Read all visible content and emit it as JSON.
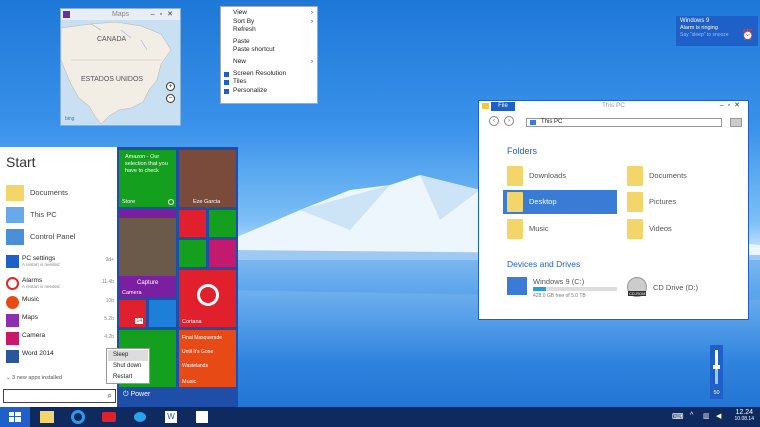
{
  "maps": {
    "title": "Maps",
    "labels": [
      "CANADA",
      "ESTADOS UNIDOS"
    ],
    "zoom_in": "+",
    "zoom_out": "−",
    "logo": "bing"
  },
  "context_menu": {
    "items": [
      {
        "label": "View",
        "arrow": "›"
      },
      {
        "label": "Sort By",
        "arrow": "›"
      },
      {
        "label": "Refresh"
      },
      {
        "label": "Paste"
      },
      {
        "label": "Paste shortcut"
      },
      {
        "label": "New",
        "arrow": "›"
      },
      {
        "label": "Screen Resolution"
      },
      {
        "label": "Tiles"
      },
      {
        "label": "Personalize"
      }
    ]
  },
  "toast": {
    "title": "Windows 9",
    "text": "Alarm is ringing",
    "sub": "Say \"sleep\" to snooze"
  },
  "explorer": {
    "file_tab": "File",
    "title": "This PC",
    "address": "This PC",
    "folders_header": "Folders",
    "folders": [
      "Downloads",
      "Documents",
      "Desktop",
      "Pictures",
      "Music",
      "Videos"
    ],
    "drives_header": "Devices and Drives",
    "drives": [
      {
        "name": "Windows 9 (C:)",
        "info": "428.0 GB free of 5.0 TB",
        "fill": 0.15
      },
      {
        "name": "CD Drive (D:)",
        "badge": "CD-ROM"
      }
    ]
  },
  "start": {
    "title": "Start",
    "pinned": [
      "Documents",
      "This PC",
      "Control Panel"
    ],
    "apps": [
      {
        "name": "PC settings",
        "sub": "A restart is needed",
        "count": "9d+"
      },
      {
        "name": "Alarms",
        "sub": "A restart is needed",
        "count": "11.4b"
      },
      {
        "name": "Music",
        "count": "10b"
      },
      {
        "name": "Maps",
        "count": "5.2b"
      },
      {
        "name": "Camera",
        "count": "4.2b"
      },
      {
        "name": "Word 2014",
        "count": ""
      }
    ],
    "more": "3 new apps installed",
    "power": "Power",
    "power_menu": [
      "Sleep",
      "Shut down",
      "Restart"
    ],
    "tiles": {
      "store_text": "Amazon - Our selection that you have to check",
      "store": "Store",
      "person": "Eze Garcia",
      "capture": "Capture",
      "camera": "Camera",
      "badge": "14",
      "cortana": "Cortana",
      "music_lines": [
        "Final Masquerade",
        "Until It's Gone",
        "Wastelands"
      ],
      "music": "Music"
    }
  },
  "volume": {
    "value": "50",
    "level": 0.5
  },
  "clock": {
    "time": "12.24",
    "date": "10.08.14"
  }
}
